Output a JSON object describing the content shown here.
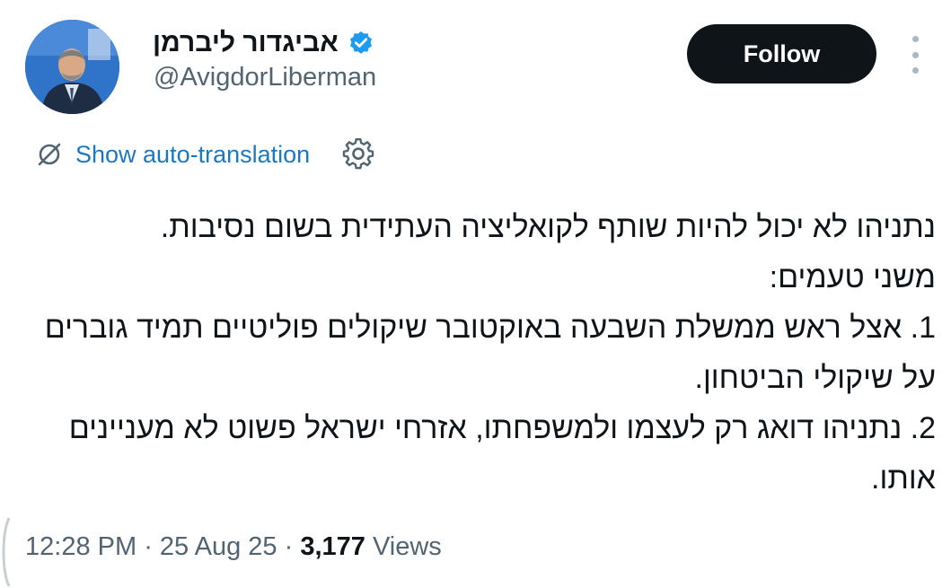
{
  "author": {
    "display_name": "אביגדור ליברמן",
    "handle": "@AvigdorLiberman",
    "verified": true,
    "avatar_icon": "profile-photo"
  },
  "actions": {
    "follow_label": "Follow",
    "more_icon": "vertical-ellipsis-icon"
  },
  "translation": {
    "label": "Show auto-translation",
    "icon": "translate-slash-icon",
    "settings_icon": "gear-icon"
  },
  "tweet": {
    "lines": [
      "נתניהו לא יכול להיות שותף לקואליציה העתידית בשום נסיבות.",
      "משני טעמים:",
      "1. אצל ראש ממשלת השבעה באוקטובר שיקולים פוליטיים תמיד גוברים על שיקולי הביטחון.",
      "2. נתניהו דואג רק לעצמו ולמשפחתו, אזרחי ישראל פשוט לא מעניינים אותו."
    ]
  },
  "meta": {
    "time": "12:28 PM",
    "sep1": " · ",
    "date": "25 Aug 25",
    "sep2": " · ",
    "views_count": "3,177",
    "views_label": " Views"
  },
  "colors": {
    "link": "#1d78c2",
    "muted": "#536471",
    "verified": "#1d9bf0",
    "button_bg": "#0f1419"
  }
}
